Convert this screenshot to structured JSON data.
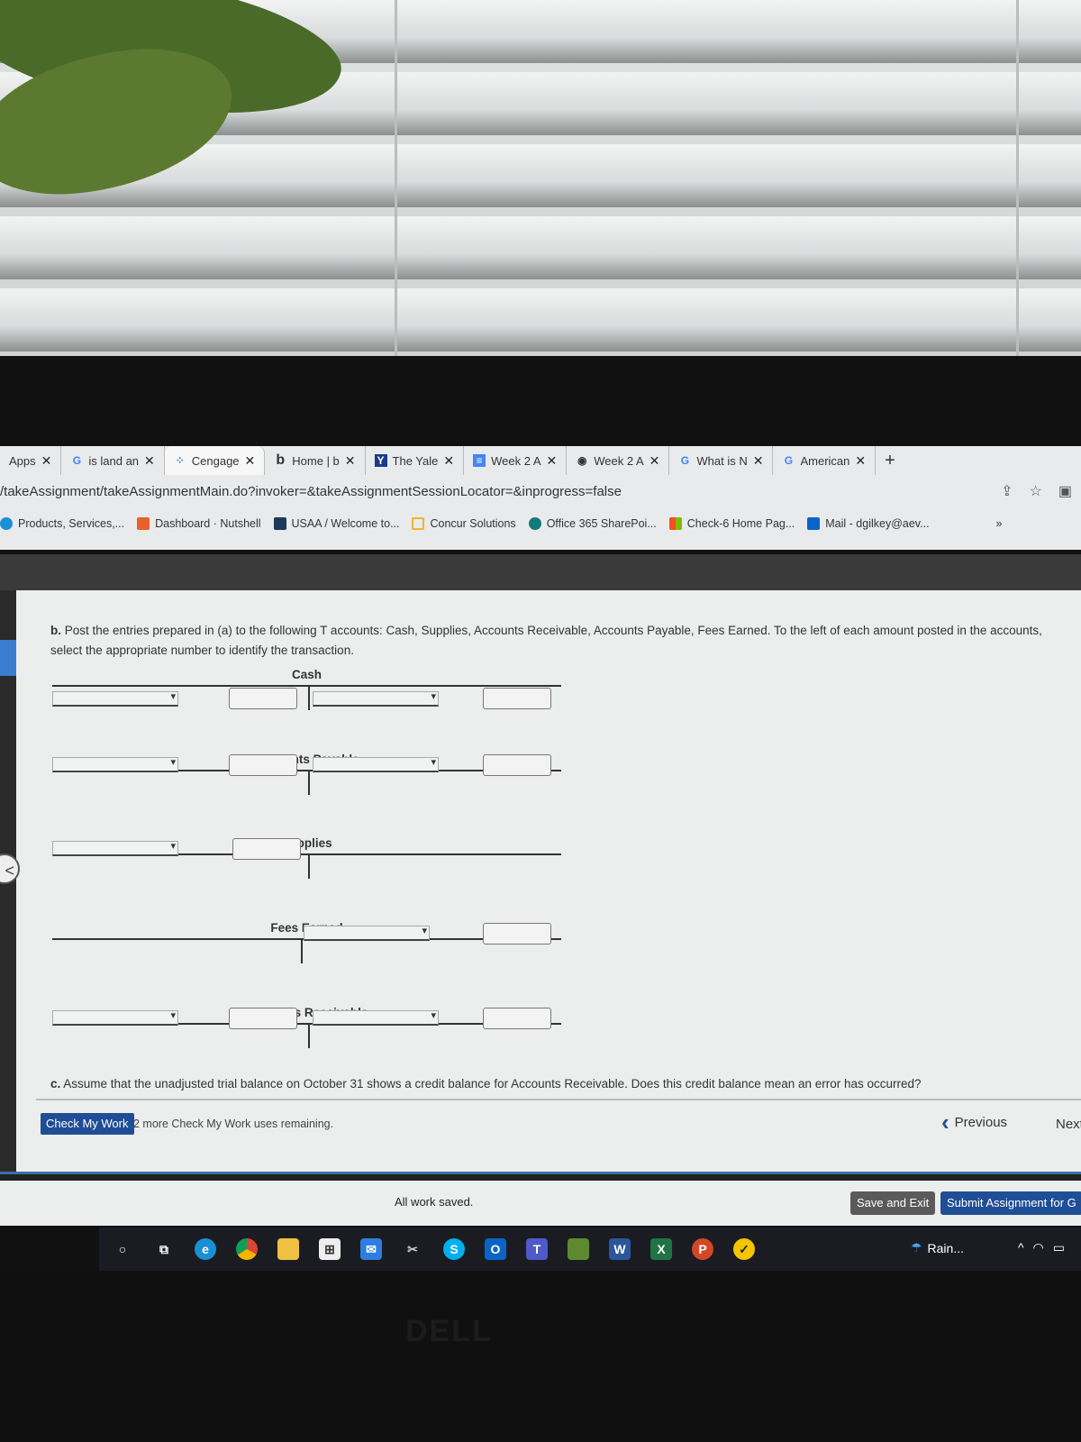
{
  "browser": {
    "tabs": [
      {
        "label": "Apps",
        "icon": "apps-icon",
        "active": false
      },
      {
        "label": "is land an",
        "icon": "google-icon",
        "active": false
      },
      {
        "label": "Cengage",
        "icon": "loading-spinner-icon",
        "active": true
      },
      {
        "label": "Home | b",
        "icon": "bing-icon",
        "active": false
      },
      {
        "label": "The Yale",
        "icon": "yale-shield-icon",
        "active": false
      },
      {
        "label": "Week 2 A",
        "icon": "docs-icon",
        "active": false
      },
      {
        "label": "Week 2 A",
        "icon": "globe-icon",
        "active": false
      },
      {
        "label": "What is N",
        "icon": "google-icon",
        "active": false
      },
      {
        "label": "American",
        "icon": "google-icon",
        "active": false
      }
    ],
    "close_glyph": "✕",
    "new_tab_glyph": "+",
    "url": "/takeAssignment/takeAssignmentMain.do?invoker=&takeAssignmentSessionLocator=&inprogress=false",
    "bookmarks": [
      {
        "label": "Products, Services,...",
        "icon": "salesforce-icon",
        "color": "#1a8fd6"
      },
      {
        "label": "Dashboard · Nutshell",
        "icon": "nutshell-icon",
        "color": "#e8622c"
      },
      {
        "label": "USAA / Welcome to...",
        "icon": "usaa-icon",
        "color": "#1b3a5c"
      },
      {
        "label": "Concur Solutions",
        "icon": "concur-icon",
        "color": "#f0b429"
      },
      {
        "label": "Office 365 SharePoi...",
        "icon": "sharepoint-icon",
        "color": "#117a7a"
      },
      {
        "label": "Check-6 Home Pag...",
        "icon": "microsoft-icon",
        "color": "#f25022"
      },
      {
        "label": "Mail - dgilkey@aev...",
        "icon": "outlook-icon",
        "color": "#0a64c8"
      }
    ],
    "more_bookmarks": "»"
  },
  "assignment": {
    "part_b": {
      "letter": "b.",
      "text": "Post the entries prepared in (a) to the following T accounts: Cash, Supplies, Accounts Receivable, Accounts Payable, Fees Earned. To the left of each amount posted in the accounts, select the appropriate number to identify the transaction."
    },
    "t_accounts": [
      {
        "name": "Cash",
        "debit_row": true,
        "credit_row": true
      },
      {
        "name": "Accounts Payable",
        "debit_row": true,
        "credit_row": true
      },
      {
        "name": "Supplies",
        "debit_row": true,
        "credit_row": false
      },
      {
        "name": "Fees Earned",
        "debit_row": false,
        "credit_row": true
      },
      {
        "name": "Accounts Receivable",
        "debit_row": true,
        "credit_row": true
      }
    ],
    "part_c": {
      "letter": "c.",
      "text": "Assume that the unadjusted trial balance on October 31 shows a credit balance for Accounts Receivable. Does this credit balance mean an error has occurred?"
    },
    "check_my_work": "Check My Work",
    "check_uses": "2 more Check My Work uses remaining.",
    "previous": "Previous",
    "next": "Next",
    "status": "All work saved.",
    "save_exit": "Save and Exit",
    "submit": "Submit Assignment for G"
  },
  "taskbar": {
    "apps": [
      "search",
      "task-view",
      "edge",
      "chrome",
      "file-explorer",
      "store",
      "mail",
      "snip",
      "skype",
      "outlook",
      "teams",
      "minecraft",
      "word",
      "excel",
      "powerpoint",
      "norton"
    ],
    "weather": "Rain..."
  },
  "monitor_brand": "DELL"
}
